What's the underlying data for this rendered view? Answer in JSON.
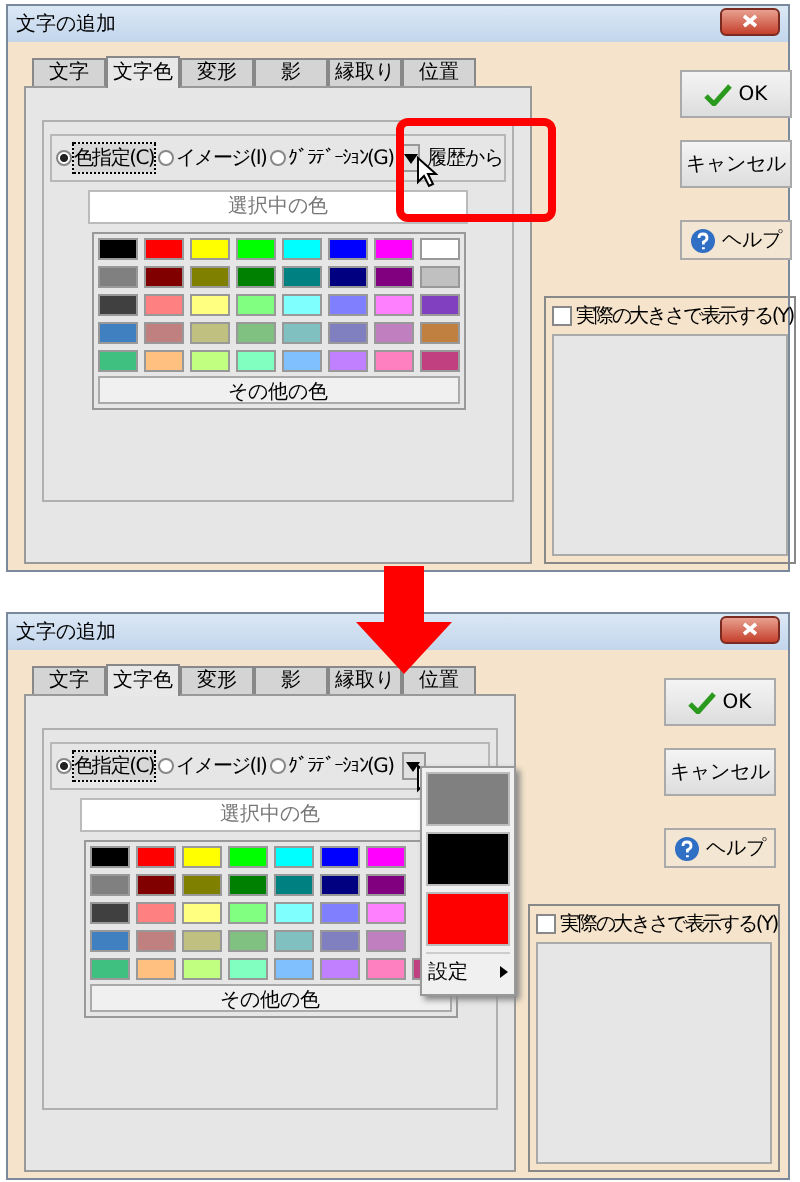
{
  "dialogs": [
    {
      "title": "文字の追加",
      "history_highlighted": true,
      "tabs": [
        {
          "label": "文字",
          "selected": false
        },
        {
          "label": "文字色",
          "selected": true
        },
        {
          "label": "変形",
          "selected": false
        },
        {
          "label": "影",
          "selected": false
        },
        {
          "label": "縁取り",
          "selected": false
        },
        {
          "label": "位置",
          "selected": false
        }
      ],
      "radios": [
        {
          "label": "色指定(C)",
          "selected": true
        },
        {
          "label": "イメージ(I)",
          "selected": false
        },
        {
          "label": "ｸﾞﾗﾃﾞｰｼｮﾝ(G)",
          "selected": false
        }
      ],
      "history_button": {
        "label": "履歴から"
      },
      "selected_color_label": "選択中の色",
      "swatch_rows": [
        [
          {
            "color": "#000000"
          },
          {
            "color": "#ff0000"
          },
          {
            "color": "#ffff00"
          },
          {
            "color": "#00ff00"
          },
          {
            "color": "#00ffff"
          },
          {
            "color": "#0000ff"
          },
          {
            "color": "#ff00ff"
          },
          {
            "color": "#ffffff"
          }
        ],
        [
          {
            "color": "#808080"
          },
          {
            "color": "#800000"
          },
          {
            "color": "#808000"
          },
          {
            "color": "#008000"
          },
          {
            "color": "#008080"
          },
          {
            "color": "#000080"
          },
          {
            "color": "#800080"
          },
          {
            "color": "#c0c0c0"
          }
        ],
        [
          {
            "color": "#404040"
          },
          {
            "color": "#ff8080"
          },
          {
            "color": "#ffff80"
          },
          {
            "color": "#80ff80"
          },
          {
            "color": "#80ffff"
          },
          {
            "color": "#8080ff"
          },
          {
            "color": "#ff80ff"
          },
          {
            "color": "#8040c0"
          }
        ],
        [
          {
            "color": "#4080c0"
          },
          {
            "color": "#c08080"
          },
          {
            "color": "#c0c080"
          },
          {
            "color": "#80c080"
          },
          {
            "color": "#80c0c0"
          },
          {
            "color": "#8080c0"
          },
          {
            "color": "#c080c0"
          },
          {
            "color": "#c08040"
          }
        ],
        [
          {
            "color": "#40c080"
          },
          {
            "color": "#ffc080"
          },
          {
            "color": "#c0ff80"
          },
          {
            "color": "#80ffc0"
          },
          {
            "color": "#80c0ff"
          },
          {
            "color": "#c080ff"
          },
          {
            "color": "#ff80c0"
          },
          {
            "color": "#c04080"
          }
        ]
      ],
      "other_colors_button": "その他の色",
      "buttons": [
        {
          "kind": "ok",
          "label": "OK"
        },
        {
          "kind": "cancel",
          "label": "キャンセル"
        },
        {
          "kind": "help",
          "label": "ヘルプ"
        }
      ],
      "preview": {
        "label": "実際の大きさで表示する(Y)",
        "checked": false
      }
    },
    {
      "title": "文字の追加",
      "history_highlighted": false,
      "tabs": [
        {
          "label": "文字",
          "selected": false
        },
        {
          "label": "文字色",
          "selected": true
        },
        {
          "label": "変形",
          "selected": false
        },
        {
          "label": "影",
          "selected": false
        },
        {
          "label": "縁取り",
          "selected": false
        },
        {
          "label": "位置",
          "selected": false
        }
      ],
      "radios": [
        {
          "label": "色指定(C)",
          "selected": true
        },
        {
          "label": "イメージ(I)",
          "selected": false
        },
        {
          "label": "ｸﾞﾗﾃﾞｰｼｮﾝ(G)",
          "selected": false
        }
      ],
      "selected_color_label": "選択中の色",
      "swatch_rows": [
        [
          {
            "color": "#000000"
          },
          {
            "color": "#ff0000"
          },
          {
            "color": "#ffff00"
          },
          {
            "color": "#00ff00"
          },
          {
            "color": "#00ffff"
          },
          {
            "color": "#0000ff"
          },
          {
            "color": "#ff00ff"
          }
        ],
        [
          {
            "color": "#808080"
          },
          {
            "color": "#800000"
          },
          {
            "color": "#808000"
          },
          {
            "color": "#008000"
          },
          {
            "color": "#008080"
          },
          {
            "color": "#000080"
          },
          {
            "color": "#800080"
          }
        ],
        [
          {
            "color": "#404040"
          },
          {
            "color": "#ff8080"
          },
          {
            "color": "#ffff80"
          },
          {
            "color": "#80ff80"
          },
          {
            "color": "#80ffff"
          },
          {
            "color": "#8080ff"
          },
          {
            "color": "#ff80ff"
          }
        ],
        [
          {
            "color": "#4080c0"
          },
          {
            "color": "#c08080"
          },
          {
            "color": "#c0c080"
          },
          {
            "color": "#80c080"
          },
          {
            "color": "#80c0c0"
          },
          {
            "color": "#8080c0"
          },
          {
            "color": "#c080c0"
          }
        ],
        [
          {
            "color": "#40c080"
          },
          {
            "color": "#ffc080"
          },
          {
            "color": "#c0ff80"
          },
          {
            "color": "#80ffc0"
          },
          {
            "color": "#80c0ff"
          },
          {
            "color": "#c080ff"
          },
          {
            "color": "#ff80c0"
          },
          {
            "color": "#c04080"
          }
        ]
      ],
      "other_colors_button": "その他の色",
      "buttons": [
        {
          "kind": "ok",
          "label": "OK"
        },
        {
          "kind": "cancel",
          "label": "キャンセル"
        },
        {
          "kind": "help",
          "label": "ヘルプ"
        }
      ],
      "preview": {
        "label": "実際の大きさで表示する(Y)",
        "checked": false
      },
      "history_menu": {
        "swatches": [
          {
            "color": "#808080"
          },
          {
            "color": "#000000"
          },
          {
            "color": "#ff0000"
          }
        ],
        "settings_label": "設定"
      }
    }
  ]
}
